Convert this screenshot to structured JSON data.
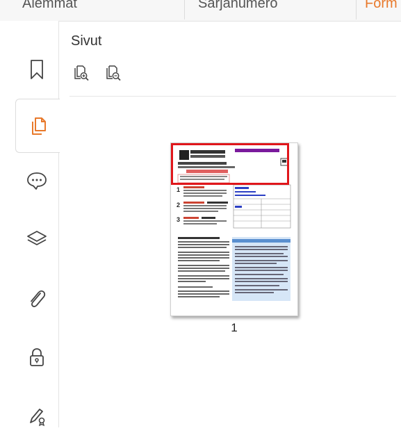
{
  "tabs": [
    {
      "label": "Aiemmat"
    },
    {
      "label": "Sarjanumero"
    },
    {
      "label": "Form"
    }
  ],
  "rail": {
    "items": [
      {
        "name": "bookmark"
      },
      {
        "name": "pages",
        "active": true
      },
      {
        "name": "comments"
      },
      {
        "name": "layers"
      },
      {
        "name": "attachments"
      },
      {
        "name": "security"
      },
      {
        "name": "signatures"
      }
    ]
  },
  "panel": {
    "title": "Sivut"
  },
  "thumbnails": [
    {
      "page_number": "1",
      "selected": true
    }
  ],
  "colors": {
    "accent": "#e8792b",
    "selection": "#e0161b",
    "icon": "#444444"
  }
}
